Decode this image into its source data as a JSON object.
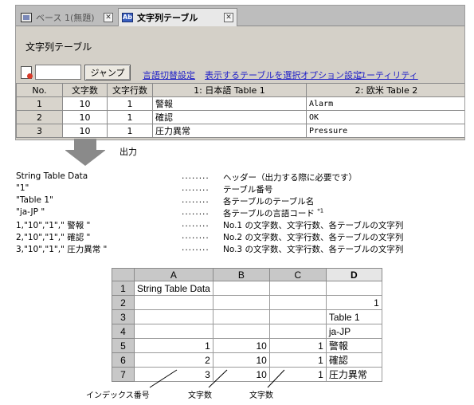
{
  "tabs": [
    {
      "label": "ベース 1(無題)",
      "icon": "base-screen-icon",
      "close": "✕"
    },
    {
      "label": "文字列テーブル",
      "icon": "string-table-icon",
      "icon_text": "Ab",
      "close": "✕"
    }
  ],
  "editor": {
    "title": "文字列テーブル",
    "jump_value": "",
    "jump_button": "ジャンプ",
    "links": [
      "言語切替設定",
      "表示するテーブルを選択",
      "オプション設定",
      "ユーティリティ"
    ]
  },
  "string_table": {
    "headers": [
      "No.",
      "文字数",
      "文字行数",
      "1: 日本語 Table 1",
      "2: 欧米 Table 2"
    ],
    "rows": [
      [
        "1",
        "10",
        "1",
        "警報",
        "Alarm"
      ],
      [
        "2",
        "10",
        "1",
        "確認",
        "OK"
      ],
      [
        "3",
        "10",
        "1",
        "圧力異常",
        "Pressure"
      ]
    ]
  },
  "output_label": "出力",
  "explanation": [
    {
      "data": "String Table Data",
      "dots": "........",
      "desc": "ヘッダー（出力する際に必要です）"
    },
    {
      "data": "\"1\"",
      "dots": "........",
      "desc": "テーブル番号"
    },
    {
      "data": "\"Table 1\"",
      "dots": "........",
      "desc": "各テーブルのテーブル名"
    },
    {
      "data": "\"ja-JP \"",
      "dots": "........",
      "desc": "各テーブルの言語コード",
      "note": "*1"
    },
    {
      "data": "1,\"10\",\"1\",\" 警報 \"",
      "dots": "........",
      "desc": "No.1 の文字数、文字行数、各テーブルの文字列"
    },
    {
      "data": "2,\"10\",\"1\",\" 確認 \"",
      "dots": "........",
      "desc": "No.2 の文字数、文字行数、各テーブルの文字列"
    },
    {
      "data": "3,\"10\",\"1\",\" 圧力異常 \"",
      "dots": "........",
      "desc": "No.3 の文字数、文字行数、各テーブルの文字列"
    }
  ],
  "spreadsheet": {
    "columns": [
      "A",
      "B",
      "C",
      "D"
    ],
    "rows": [
      {
        "n": "1",
        "cells": [
          "String Table  Data",
          "",
          "",
          ""
        ]
      },
      {
        "n": "2",
        "cells": [
          "",
          "",
          "",
          "1"
        ]
      },
      {
        "n": "3",
        "cells": [
          "",
          "",
          "",
          "Table 1"
        ]
      },
      {
        "n": "4",
        "cells": [
          "",
          "",
          "",
          "ja-JP"
        ]
      },
      {
        "n": "5",
        "cells": [
          "1",
          "10",
          "1",
          "警報"
        ]
      },
      {
        "n": "6",
        "cells": [
          "2",
          "10",
          "1",
          "確認"
        ]
      },
      {
        "n": "7",
        "cells": [
          "3",
          "10",
          "1",
          "圧力異常"
        ]
      }
    ]
  },
  "annotations": [
    "インデックス番号",
    "文字数",
    "文字数"
  ],
  "colors": {
    "link": "#1f1fc8",
    "header_bg": "#d8d4cc",
    "arrow": "#8a8a8a"
  }
}
